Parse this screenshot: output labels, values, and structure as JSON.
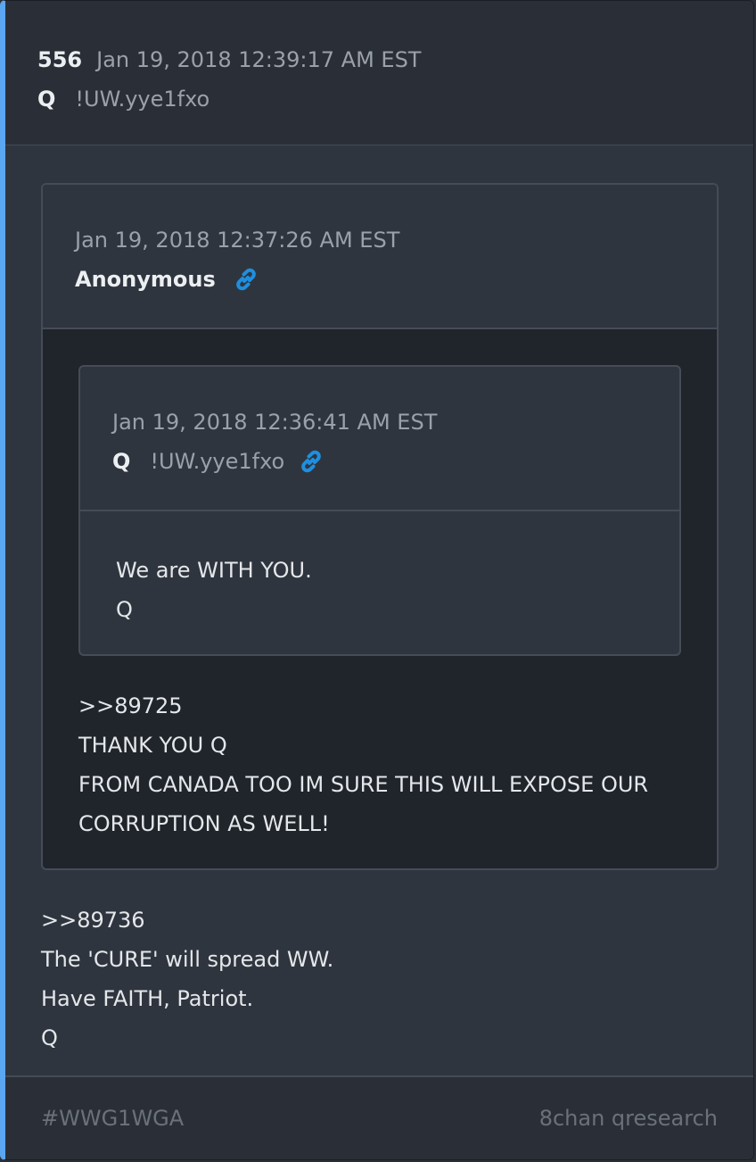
{
  "post": {
    "number": "556",
    "date": "Jan 19, 2018 12:39:17 AM EST",
    "author": "Q",
    "tripcode": "!UW.yye1fxo"
  },
  "quote1": {
    "date": "Jan 19, 2018 12:37:26 AM EST",
    "author": "Anonymous",
    "lines": [
      ">>89725",
      "THANK YOU Q",
      "FROM CANADA TOO IM SURE THIS WILL EXPOSE OUR",
      "CORRUPTION AS WELL!"
    ]
  },
  "quote2": {
    "date": "Jan 19, 2018 12:36:41 AM EST",
    "author": "Q",
    "tripcode": "!UW.yye1fxo",
    "lines": [
      "We are WITH YOU.",
      "Q"
    ]
  },
  "main_text": [
    ">>89736",
    "The 'CURE' will spread WW.",
    "Have FAITH, Patriot.",
    "Q"
  ],
  "footer": {
    "hashtag": "#WWG1WGA",
    "source": "8chan qresearch"
  },
  "colors": {
    "accent": "#5aa6f0",
    "link_icon": "#1e8fe0"
  },
  "icons": {
    "link": "link-icon"
  }
}
